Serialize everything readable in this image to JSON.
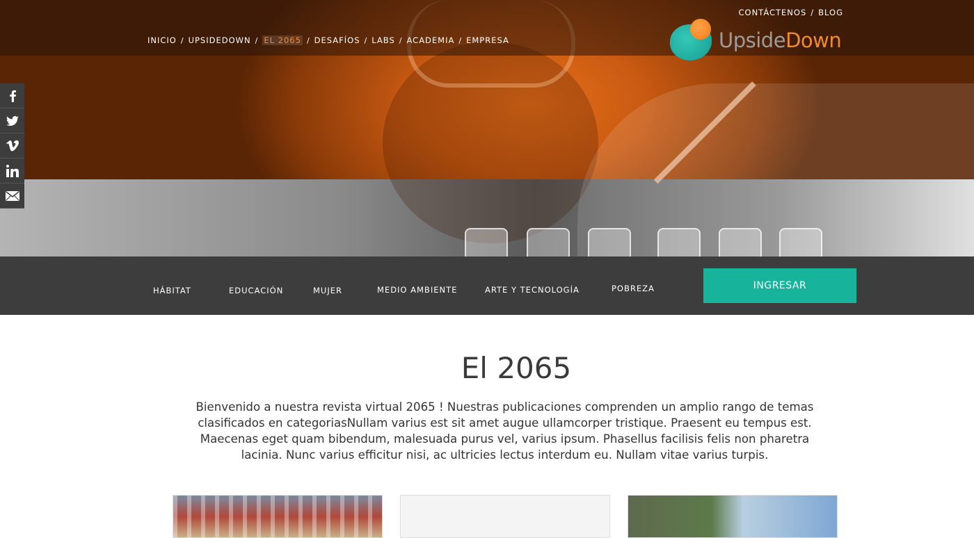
{
  "nav": {
    "main": [
      "INICIO",
      "UPSIDEDOWN",
      "EL 2065",
      "DESAFÍOS",
      "LABS",
      "ACADEMIA",
      "EMPRESA"
    ],
    "active": "EL 2065",
    "utility": [
      "CONTÁCTENOS",
      "BLOG"
    ]
  },
  "logo": {
    "upside": "Upside",
    "down": "Down"
  },
  "social": [
    "facebook-icon",
    "twitter-icon",
    "vimeo-icon",
    "linkedin-icon",
    "email-icon"
  ],
  "categories": [
    "HÁBITAT",
    "EDUCACIÓN",
    "MUJER",
    "MEDIO AMBIENTE",
    "ARTE Y TECNOLOGÍA",
    "POBREZA"
  ],
  "ingresar_label": "INGRESAR",
  "colors": {
    "accent_orange": "#f08a2e",
    "accent_teal": "#17b39b",
    "dark_bar": "#3d3d3d"
  },
  "main": {
    "title": "El 2065",
    "intro": "Bienvenido a nuestra revista virtual 2065 ! Nuestras publicaciones comprenden un amplio rango de temas clasificados en categoriasNullam varius est sit amet augue ullamcorper tristique. Praesent eu tempus est. Maecenas eget quam bibendum, malesuada purus vel, varius ipsum. Phasellus facilisis felis non pharetra lacinia. Nunc varius efficitur nisi, ac ultricies lectus interdum eu. Nullam vitae varius turpis."
  }
}
